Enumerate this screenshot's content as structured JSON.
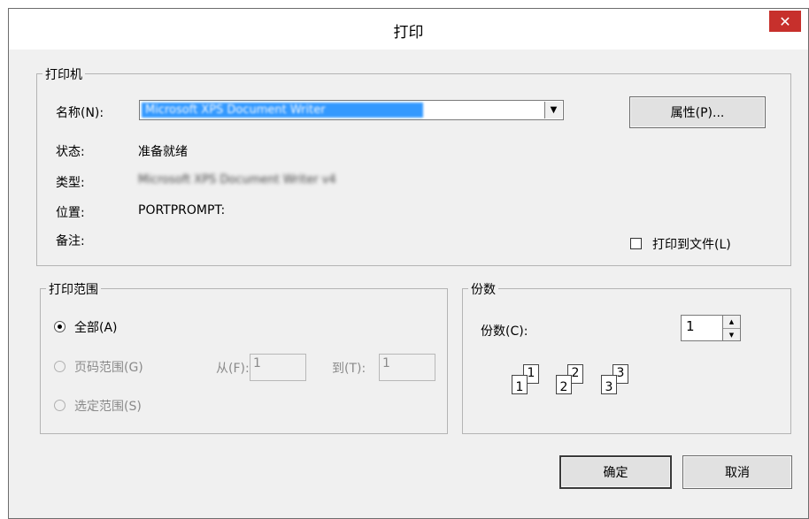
{
  "window": {
    "title": "打印",
    "close_glyph": "✕"
  },
  "printer_group": {
    "legend": "打印机",
    "name_label": "名称(N):",
    "name_value": "Microsoft XPS Document Writer",
    "properties_button": "属性(P)...",
    "status_label": "状态:",
    "status_value": "准备就绪",
    "type_label": "类型:",
    "type_value": "Microsoft XPS Document Writer v4",
    "location_label": "位置:",
    "location_value": "PORTPROMPT:",
    "comment_label": "备注:",
    "print_to_file_label": "打印到文件(L)"
  },
  "range_group": {
    "legend": "打印范围",
    "all_label": "全部(A)",
    "pages_label": "页码范围(G)",
    "from_label": "从(F):",
    "from_value": "1",
    "to_label": "到(T):",
    "to_value": "1",
    "selection_label": "选定范围(S)"
  },
  "copies_group": {
    "legend": "份数",
    "copies_label": "份数(C):",
    "copies_value": "1",
    "collate_pages": [
      "1",
      "1",
      "2",
      "2",
      "3",
      "3"
    ]
  },
  "footer": {
    "ok_button": "确定",
    "cancel_button": "取消"
  }
}
